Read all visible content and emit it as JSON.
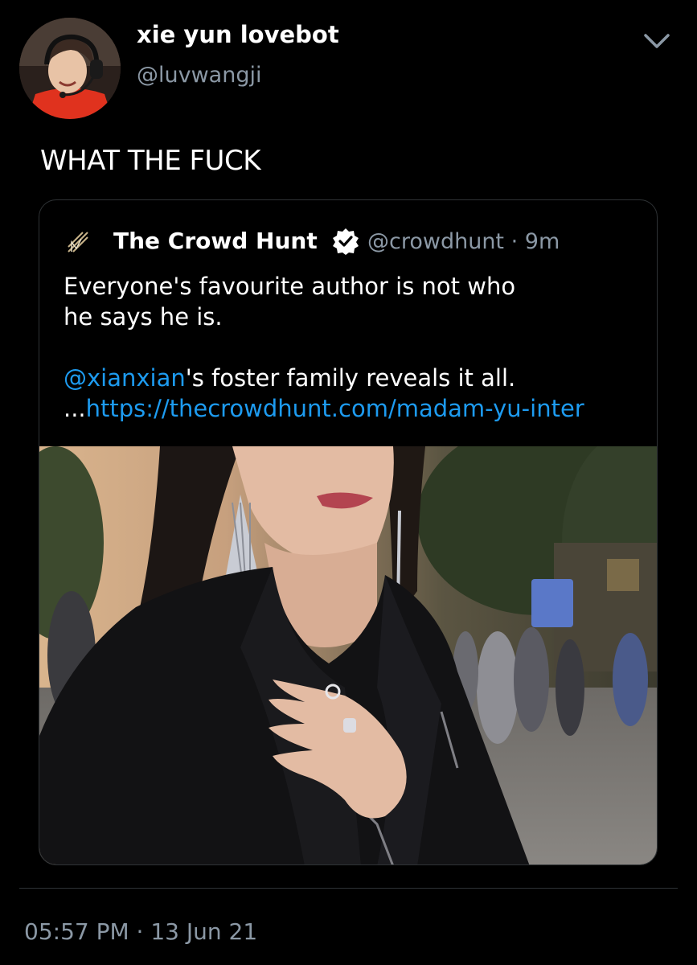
{
  "colors": {
    "background": "#000000",
    "primary_text": "#ffffff",
    "secondary_text": "#8b98a5",
    "link": "#1d9bf0",
    "border": "#2f3336"
  },
  "tweet": {
    "author": {
      "display_name": "xie yun lovebot",
      "handle": "@luvwangji",
      "avatar_icon": "profile-avatar"
    },
    "menu_icon": "chevron-down-icon",
    "text": "WHAT THE FUCK",
    "quoted": {
      "logo_icon": "crowd-hunt-logo",
      "display_name": "The Crowd Hunt",
      "verified_icon": "verified-badge-icon",
      "handle": "@crowdhunt",
      "separator": " · ",
      "time_ago": "9m",
      "line1": "Everyone's favourite author is not who",
      "line2": "he says he is.",
      "mention": "@xianxian",
      "line3_rest": "'s foster family reveals it all.",
      "link_prefix": "...",
      "link": "https://thecrowdhunt.com/madam-yu-inter",
      "image_alt_icon": "woman-portrait-image"
    },
    "time": "05:57 PM",
    "date_separator": " · ",
    "date": "13 Jun 21"
  }
}
